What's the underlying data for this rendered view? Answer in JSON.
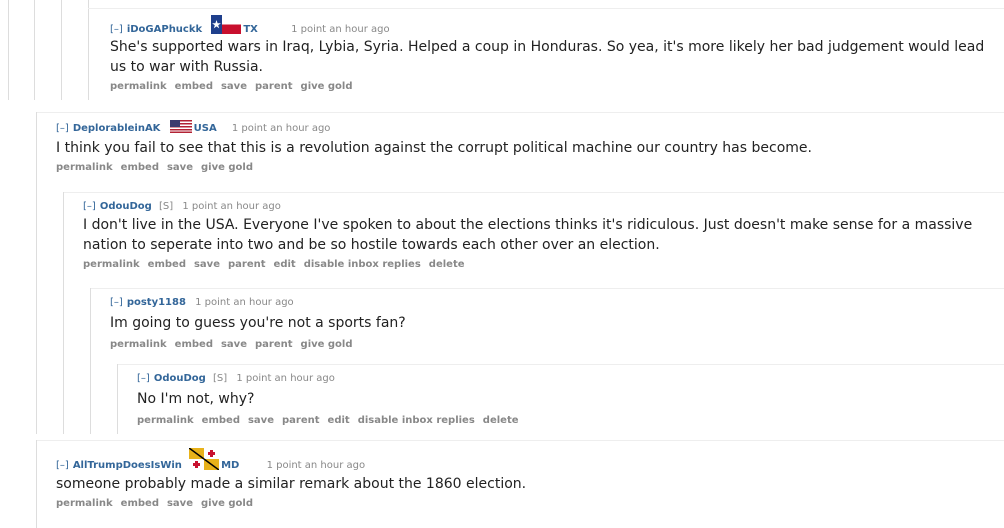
{
  "comments": [
    {
      "expand": "[–]",
      "author": "iDoGAPhuckk",
      "flair": "TX",
      "sub": "",
      "time": "1 point an hour ago",
      "body": "She's supported wars in Iraq, Lybia, Syria. Helped a coup in Honduras. So yea, it's more likely her bad judgement would lead us to war with Russia.",
      "buttons": [
        "permalink",
        "embed",
        "save",
        "parent",
        "give gold"
      ],
      "flag": "texas-flag"
    },
    {
      "expand": "[–]",
      "author": "DeplorableinAK",
      "flair": "USA",
      "sub": "",
      "time": "1 point an hour ago",
      "body": "I think you fail to see that this is a revolution against the corrupt political machine our country has become.",
      "buttons": [
        "permalink",
        "embed",
        "save",
        "give gold"
      ],
      "flag": "usa-flag"
    },
    {
      "expand": "[–]",
      "author": "OdouDog",
      "flair": "",
      "sub": "[S]",
      "time": "1 point an hour ago",
      "body": "I don't live in the USA. Everyone I've spoken to about the elections thinks it's ridiculous. Just doesn't make sense for a massive nation to seperate into two and be so hostile towards each other over an election.",
      "buttons": [
        "permalink",
        "embed",
        "save",
        "parent",
        "edit",
        "disable inbox replies",
        "delete"
      ]
    },
    {
      "expand": "[–]",
      "author": "posty1188",
      "flair": "",
      "sub": "",
      "time": "1 point an hour ago",
      "body": "Im going to guess you're not a sports fan?",
      "buttons": [
        "permalink",
        "embed",
        "save",
        "parent",
        "give gold"
      ]
    },
    {
      "expand": "[–]",
      "author": "OdouDog",
      "flair": "",
      "sub": "[S]",
      "time": "1 point an hour ago",
      "body": "No I'm not, why?",
      "buttons": [
        "permalink",
        "embed",
        "save",
        "parent",
        "edit",
        "disable inbox replies",
        "delete"
      ]
    },
    {
      "expand": "[–]",
      "author": "AllTrumpDoesIsWin",
      "flair": "MD",
      "sub": "",
      "time": "1 point an hour ago",
      "body": "someone probably made a similar remark about the 1860 election.",
      "buttons": [
        "permalink",
        "embed",
        "save",
        "give gold"
      ],
      "flag": "maryland-flag"
    }
  ]
}
